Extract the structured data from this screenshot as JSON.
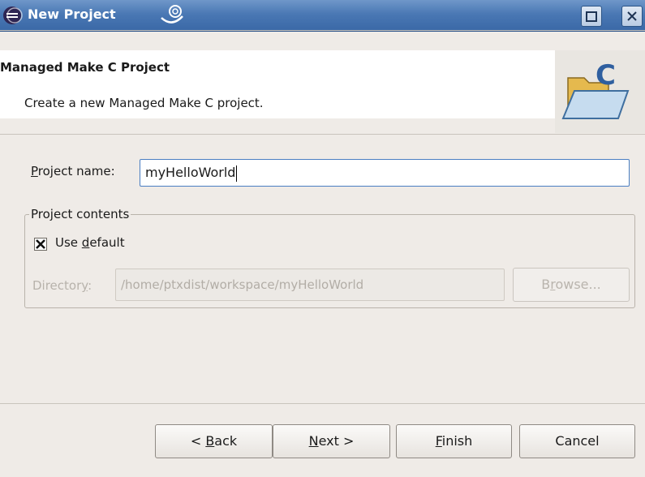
{
  "window": {
    "title": "New Project",
    "maximize_icon": "maximize-icon",
    "close_icon": "close-icon",
    "title_icon": "eclipse-icon"
  },
  "banner": {
    "title": "Managed Make C Project",
    "description": "Create a new Managed Make C project.",
    "image_icon": "c-folder-icon"
  },
  "form": {
    "project_name_label_mnemonic": "P",
    "project_name_label_rest": "roject name:",
    "project_name_value": "myHelloWorld",
    "group_title": "Project contents",
    "use_default_prefix": "Use ",
    "use_default_mnemonic": "d",
    "use_default_rest": "efault",
    "use_default_checked": true,
    "directory_label_prefix": "Director",
    "directory_label_mnemonic": "y",
    "directory_label_suffix": ":",
    "directory_value": "/home/ptxdist/workspace/myHelloWorld",
    "browse_prefix": "B",
    "browse_mnemonic": "r",
    "browse_rest": "owse..."
  },
  "buttons": {
    "back_prefix": "< ",
    "back_mnemonic": "B",
    "back_rest": "ack",
    "next_mnemonic": "N",
    "next_rest": "ext >",
    "finish_mnemonic": "F",
    "finish_rest": "inish",
    "cancel": "Cancel"
  },
  "colors": {
    "titlebar": "#4a78b4",
    "dialog_bg": "#efebe7",
    "focus_border": "#4a7ec2"
  }
}
